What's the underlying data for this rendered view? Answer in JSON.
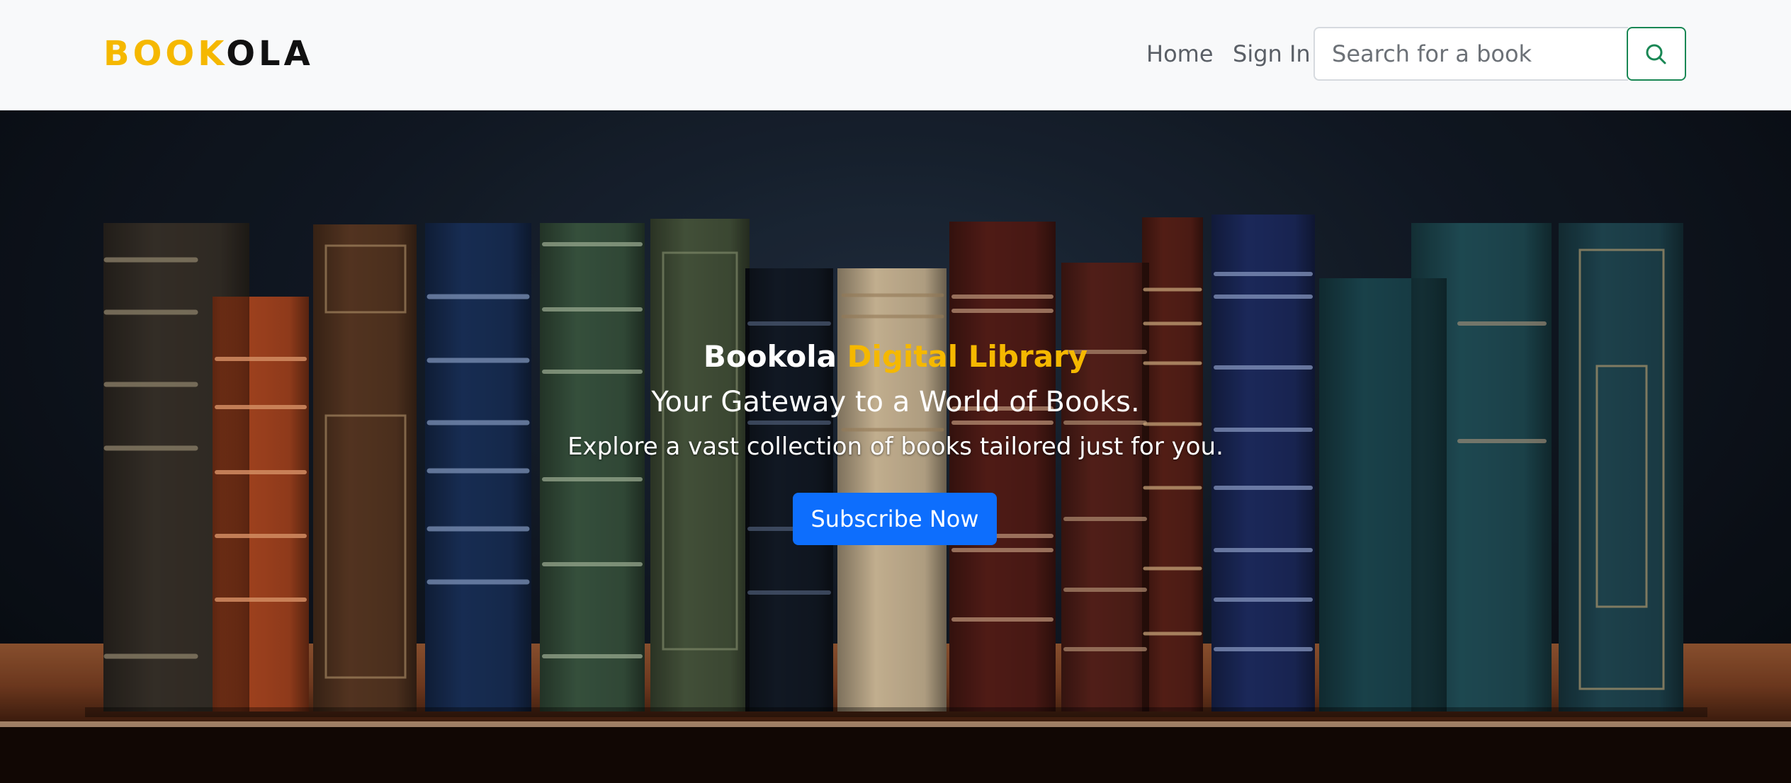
{
  "navbar": {
    "brand_part1": "BOOK",
    "brand_part2": "OLA",
    "links": [
      {
        "label": "Home"
      },
      {
        "label": "Sign In"
      }
    ],
    "search": {
      "placeholder": "Search for a book",
      "button_icon": "search-icon"
    }
  },
  "hero": {
    "title_part1": "Bookola",
    "title_part2": "Digital Library",
    "tagline": "Your Gateway to a World of Books.",
    "description": "Explore a vast collection of books tailored just for you.",
    "cta_label": "Subscribe Now",
    "background": "photo of antique leather-bound books on a wooden shelf"
  },
  "colors": {
    "brand_accent": "#f5b800",
    "brand_dark": "#111111",
    "cta_blue": "#0d6efd",
    "search_button_border": "#198754",
    "navbar_bg": "#f8f9fa"
  }
}
